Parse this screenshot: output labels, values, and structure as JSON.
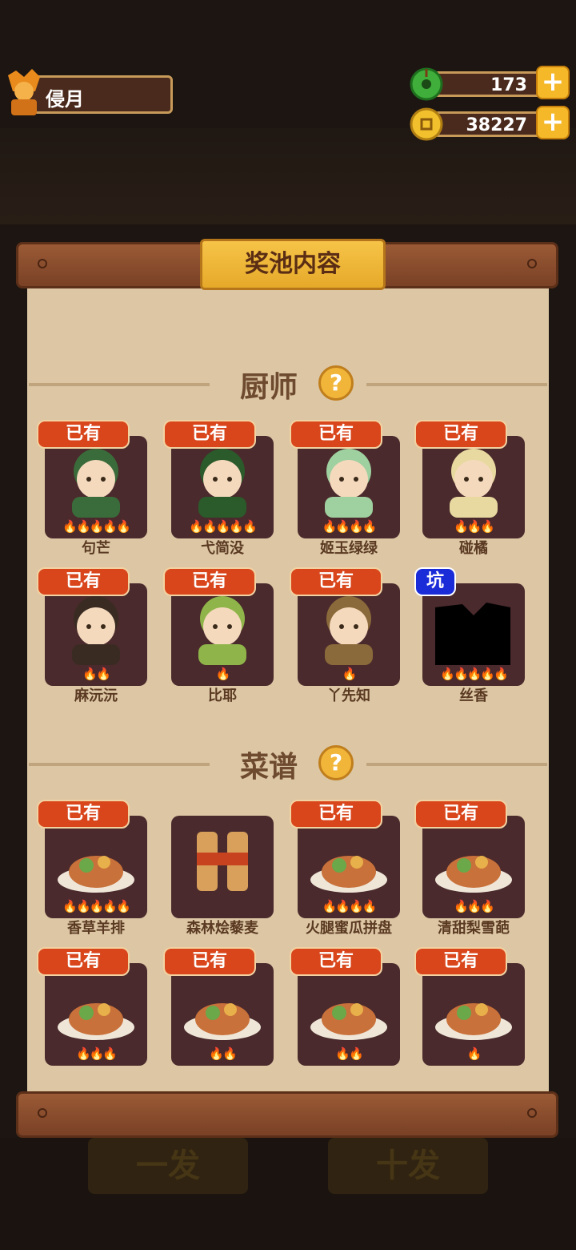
{
  "header": {
    "player_name": "侵月",
    "jade_value": "173",
    "coin_value": "38227",
    "add_symbol": "+"
  },
  "panel": {
    "title": "奖池内容",
    "chef_section": "厨师",
    "recipe_section": "菜谱",
    "help_symbol": "?"
  },
  "chefs": [
    {
      "name": "句芒",
      "badge": "已有",
      "flames": "🔥🔥🔥🔥🔥"
    },
    {
      "name": "弋简没",
      "badge": "已有",
      "flames": "🔥🔥🔥🔥🔥"
    },
    {
      "name": "姬玉绿绿",
      "badge": "已有",
      "flames": "🔥🔥🔥🔥"
    },
    {
      "name": "碰橘",
      "badge": "已有",
      "flames": "🔥🔥🔥"
    },
    {
      "name": "麻沅沅",
      "badge": "已有",
      "flames": "🔥🔥"
    },
    {
      "name": "比耶",
      "badge": "已有",
      "flames": "🔥"
    },
    {
      "name": "丫先知",
      "badge": "已有",
      "flames": "🔥"
    },
    {
      "name": "丝香",
      "badge": "坑",
      "flames": "🔥🔥🔥🔥🔥"
    }
  ],
  "recipes": [
    {
      "name": "香草羊排",
      "badge": "已有",
      "flames": "🔥🔥🔥🔥🔥"
    },
    {
      "name": "森林烩藜麦",
      "badge": "",
      "flames": ""
    },
    {
      "name": "火腿蜜瓜拼盘",
      "badge": "已有",
      "flames": "🔥🔥🔥🔥"
    },
    {
      "name": "清甜梨雪葩",
      "badge": "已有",
      "flames": "🔥🔥🔥"
    },
    {
      "name": "",
      "badge": "已有",
      "flames": "🔥🔥🔥"
    },
    {
      "name": "",
      "badge": "已有",
      "flames": "🔥🔥"
    },
    {
      "name": "",
      "badge": "已有",
      "flames": "🔥🔥"
    },
    {
      "name": "",
      "badge": "已有",
      "flames": "🔥"
    }
  ],
  "background_buttons": {
    "single": "一发",
    "ten": "十发"
  }
}
